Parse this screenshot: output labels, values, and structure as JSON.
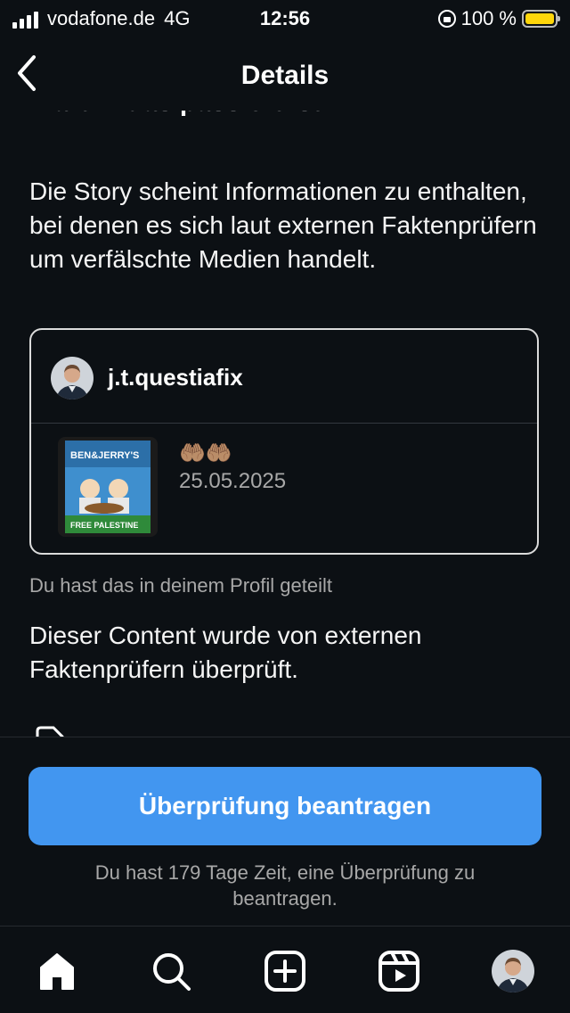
{
  "status_bar": {
    "carrier": "vodafone.de",
    "network": "4G",
    "time": "12:56",
    "battery_percent": "100 %",
    "icons": [
      "signal-icon",
      "orientation-lock-icon",
      "battery-icon"
    ]
  },
  "header": {
    "title": "Details",
    "back_icon": "chevron-left-icon"
  },
  "content": {
    "section_heading": "Warum das passiert ist",
    "description": "Die Story scheint Informationen zu enthalten, bei denen es sich laut externen Faktenprüfern um verfälschte Medien handelt.",
    "post": {
      "username": "j.t.questiafix",
      "emoji": "🤲🏽🤲🏽",
      "date": "25.05.2025",
      "thumbnail_text": "BEN&JERRY'S",
      "thumbnail_caption": "FREE PALESTINE"
    },
    "shared_note": "Du hast das in deinem Profil geteilt",
    "checked_text": "Dieser Content wurde von externen Faktenprüfern überprüft."
  },
  "footer": {
    "request_button_label": "Überprüfung beantragen",
    "deadline_text": "Du hast 179 Tage Zeit, eine Überprüfung zu beantragen."
  },
  "tab_bar": {
    "items": [
      "home-icon",
      "search-icon",
      "create-icon",
      "reels-icon",
      "profile-avatar"
    ]
  },
  "colors": {
    "background": "#0c1014",
    "primary_button": "#4296f0",
    "secondary_text": "#a8a8a8",
    "battery": "#ffd60a"
  }
}
